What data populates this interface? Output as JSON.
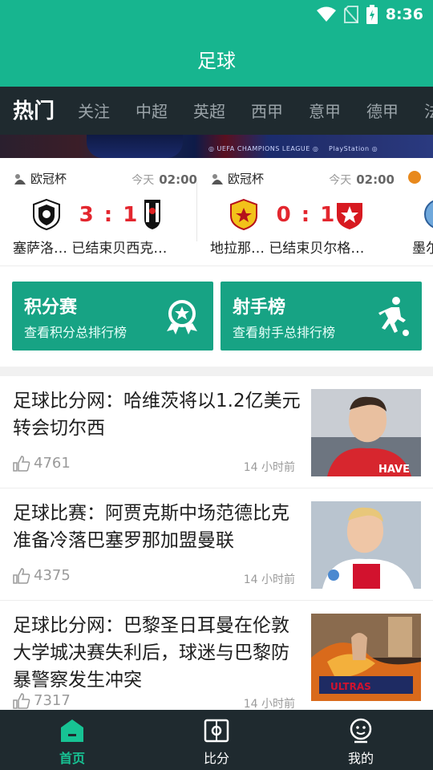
{
  "status_bar": {
    "time": "8:36"
  },
  "app_title": "足球",
  "tabs": [
    "热门",
    "关注",
    "中超",
    "英超",
    "西甲",
    "意甲",
    "德甲",
    "法"
  ],
  "matches": [
    {
      "competition": "欧冠杯",
      "date_label": "今天",
      "time": "02:00",
      "score": "3 : 1",
      "names": "塞萨洛…  已结束贝西克…"
    },
    {
      "competition": "欧冠杯",
      "date_label": "今天",
      "time": "02:00",
      "score": "0 : 1",
      "names": "地拉那…  已结束贝尔格…"
    },
    {
      "competition": "",
      "date_label": "",
      "time": "",
      "score": "",
      "names": "墨尔"
    }
  ],
  "features": [
    {
      "title": "积分赛",
      "subtitle": "查看积分总排行榜",
      "icon": "medal-icon"
    },
    {
      "title": "射手榜",
      "subtitle": "查看射手总排行榜",
      "icon": "kicker-icon"
    }
  ],
  "news": [
    {
      "title": "足球比分网：哈维茨将以1.2亿美元转会切尔西",
      "likes": "4761",
      "time": "14 小时前"
    },
    {
      "title": "足球比赛：阿贾克斯中场范德比克准备冷落巴塞罗那加盟曼联",
      "likes": "4375",
      "time": "14 小时前"
    },
    {
      "title": "足球比分网：巴黎圣日耳曼在伦敦大学城决赛失利后，球迷与巴黎防暴警察发生冲突",
      "likes": "7317",
      "time": "14 小时前"
    }
  ],
  "bottom_nav": [
    {
      "label": "首页",
      "icon": "home-icon",
      "active": true
    },
    {
      "label": "比分",
      "icon": "scoreboard-icon",
      "active": false
    },
    {
      "label": "我的",
      "icon": "profile-icon",
      "active": false
    }
  ],
  "colors": {
    "primary": "#17b58f",
    "dark": "#1f2a2f",
    "score_red": "#e3262e",
    "feature_green": "#17a384"
  }
}
